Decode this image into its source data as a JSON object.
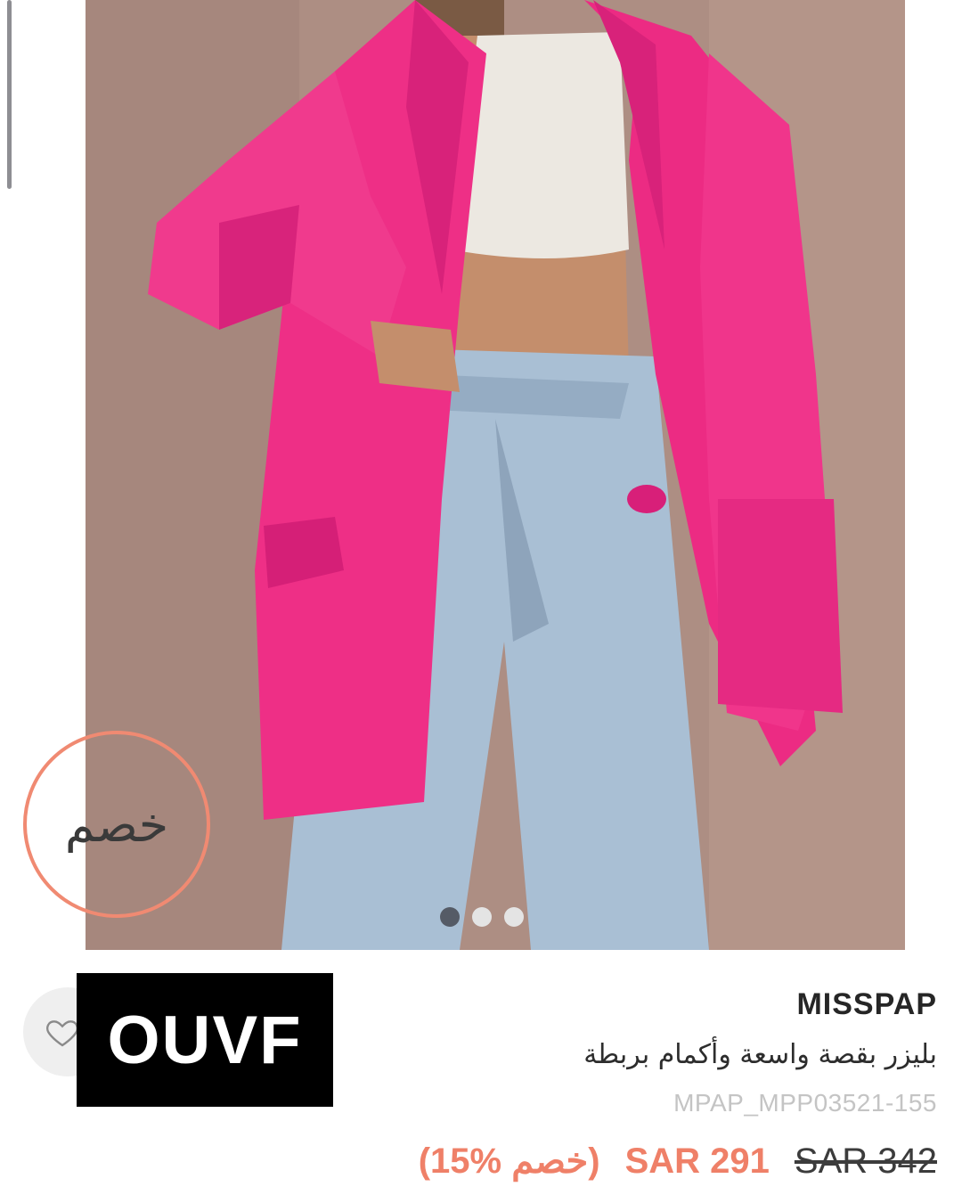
{
  "discount_badge": "خصم",
  "watermark": "OUVF",
  "gallery": {
    "total_images": 3,
    "active_index": 0
  },
  "product": {
    "brand": "MISSPAP",
    "title": "بليزر بقصة واسعة وأكمام بربطة",
    "sku": "MPAP_MPP03521-155",
    "discount_label": "(15% خصم)",
    "sale_price": "SAR 291",
    "original_price": "SAR 342"
  },
  "colors": {
    "accent": "#ef8068",
    "blazer": "#ee2f86",
    "denim": "#a9bfd4",
    "wall": "#ad8e83"
  }
}
